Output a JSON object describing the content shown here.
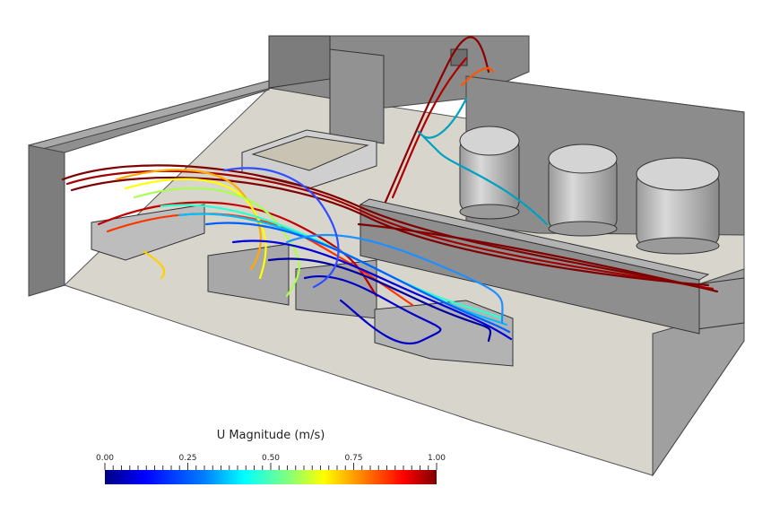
{
  "legend": {
    "title": "U Magnitude (m/s)",
    "ticks": [
      {
        "label": "0.00",
        "value": 0.0
      },
      {
        "label": "0.25",
        "value": 0.25
      },
      {
        "label": "0.50",
        "value": 0.5
      },
      {
        "label": "0.75",
        "value": 0.75
      },
      {
        "label": "1.00",
        "value": 1.0
      }
    ],
    "range": [
      0.0,
      1.0
    ],
    "colormap": [
      "#00007f",
      "#0000ff",
      "#007fff",
      "#00ffff",
      "#7fff7f",
      "#ffff00",
      "#ff7f00",
      "#ff0000",
      "#7f0000"
    ]
  },
  "scene": {
    "background": "#ffffff",
    "wall_color": "#8c8c8c",
    "floor_color": "#d8d5cc",
    "tank_color": "#bdbdbd",
    "tank_count": 3
  }
}
